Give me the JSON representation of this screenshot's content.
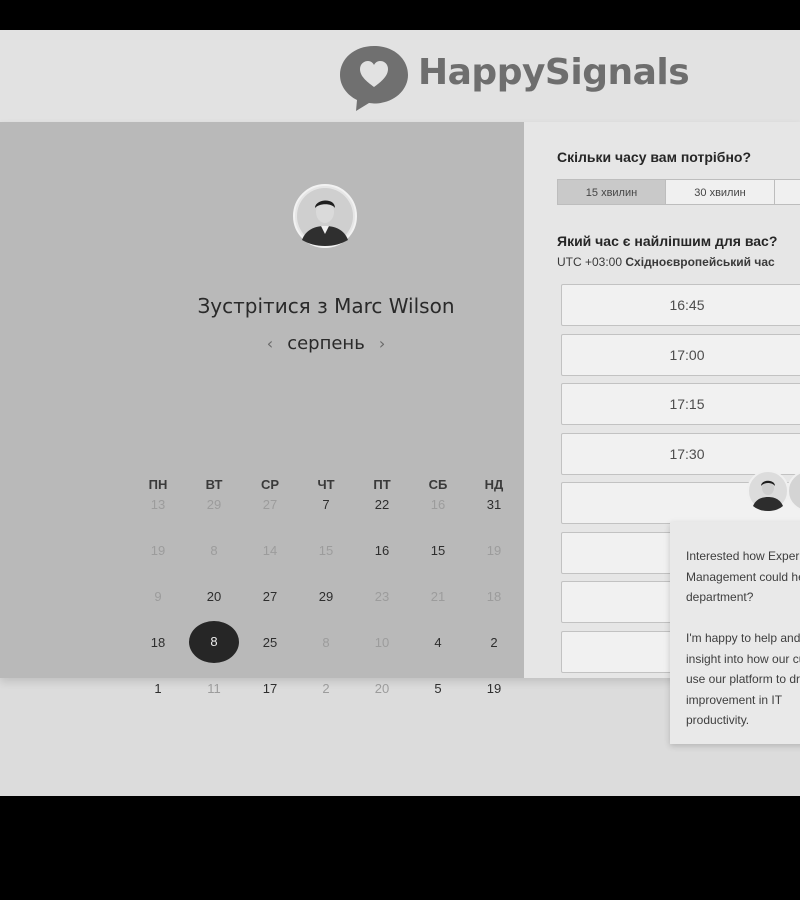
{
  "brand": {
    "name": "HappySignals",
    "icon": "heart-speech-bubble-icon"
  },
  "booking": {
    "title": "Зустрітися з Marc Wilson",
    "avatar": "person-avatar",
    "month": "серпень",
    "prev_icon": "chevron-left-icon",
    "next_icon": "chevron-right-icon",
    "weekdays": [
      "ПН",
      "ВТ",
      "СР",
      "ЧТ",
      "ПТ",
      "СБ",
      "НД"
    ],
    "weeks": [
      [
        {
          "d": "13",
          "m": true
        },
        {
          "d": "29",
          "m": true
        },
        {
          "d": "27",
          "m": true
        },
        {
          "d": "7",
          "m": false
        },
        {
          "d": "22",
          "m": false
        },
        {
          "d": "16",
          "m": true
        },
        {
          "d": "31",
          "m": false
        }
      ],
      [
        {
          "d": "19",
          "m": true
        },
        {
          "d": "8",
          "m": true
        },
        {
          "d": "14",
          "m": true
        },
        {
          "d": "15",
          "m": true
        },
        {
          "d": "16",
          "m": false
        },
        {
          "d": "15",
          "m": false
        },
        {
          "d": "19",
          "m": true
        }
      ],
      [
        {
          "d": "9",
          "m": true
        },
        {
          "d": "20",
          "m": false
        },
        {
          "d": "27",
          "m": false
        },
        {
          "d": "29",
          "m": false
        },
        {
          "d": "23",
          "m": true
        },
        {
          "d": "21",
          "m": true
        },
        {
          "d": "18",
          "m": true
        }
      ],
      [
        {
          "d": "18",
          "m": false
        },
        {
          "d": "8",
          "m": false,
          "s": true
        },
        {
          "d": "25",
          "m": false
        },
        {
          "d": "8",
          "m": true
        },
        {
          "d": "10",
          "m": true
        },
        {
          "d": "4",
          "m": false
        },
        {
          "d": "2",
          "m": false
        }
      ],
      [
        {
          "d": "1",
          "m": false
        },
        {
          "d": "11",
          "m": true
        },
        {
          "d": "17",
          "m": false
        },
        {
          "d": "2",
          "m": true
        },
        {
          "d": "20",
          "m": true
        },
        {
          "d": "5",
          "m": false
        },
        {
          "d": "19",
          "m": false
        }
      ]
    ]
  },
  "duration": {
    "question": "Скільки часу вам потрібно?",
    "options": [
      "15 хвилин",
      "30 хвилин"
    ],
    "selected": "15 хвилин"
  },
  "time": {
    "question": "Який час є найліпшим для вас?",
    "timezone_offset": "UTC +03:00",
    "timezone_name": "Східноєвропейський час",
    "slots": [
      "16:45",
      "17:00",
      "17:15",
      "17:30",
      "",
      "",
      "",
      ""
    ]
  },
  "chat": {
    "message": "Interested how Experience\nManagement could help your IT\ndepartment?\n\nI'm happy to help and give\ninsight into how our customers\nuse our platform to drive\nimprovement in IT\nproductivity."
  }
}
